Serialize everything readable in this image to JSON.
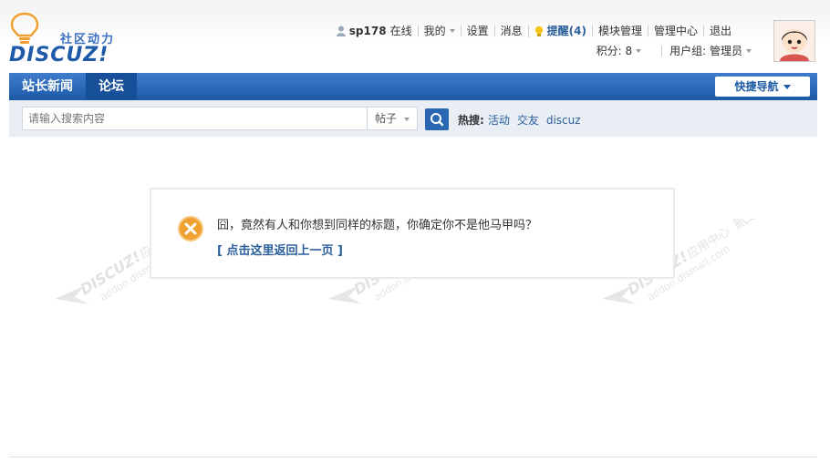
{
  "brand": {
    "logo_text": "DISCUZ!",
    "slogan": "社区动力"
  },
  "user_bar": {
    "username": "sp178",
    "online_status": "在线",
    "my": "我的",
    "settings": "设置",
    "messages": "消息",
    "reminders": "提醒(4)",
    "module_manage": "模块管理",
    "admin_center": "管理中心",
    "logout": "退出",
    "points": "积分: 8",
    "user_group": "用户组: 管理员"
  },
  "nav": {
    "tabs": [
      {
        "label": "站长新闻",
        "active": false
      },
      {
        "label": "论坛",
        "active": true
      }
    ],
    "quick_nav": "快捷导航"
  },
  "search": {
    "placeholder": "请输入搜索内容",
    "type_selected": "帖子",
    "hot_label": "热搜:",
    "hot_terms": [
      "活动",
      "交友",
      "discuz"
    ]
  },
  "message": {
    "text": "囧，竟然有人和你想到同样的标题，你确定你不是他马甲吗？",
    "back_link": "[ 点击这里返回上一页 ]"
  },
  "watermark": {
    "brand": "DISCUZ!",
    "cn_text": "应用中心",
    "side_text": "贰道",
    "domain": "addon.dismall.com"
  },
  "colors": {
    "nav_blue": "#1c5aa6",
    "link_blue": "#2b5f9c",
    "error_orange": "#f0a030",
    "search_bg": "#e8eef4"
  },
  "icons": {
    "user": "user-icon",
    "bulb": "bulb-icon",
    "search": "search-icon",
    "error": "error-icon"
  }
}
